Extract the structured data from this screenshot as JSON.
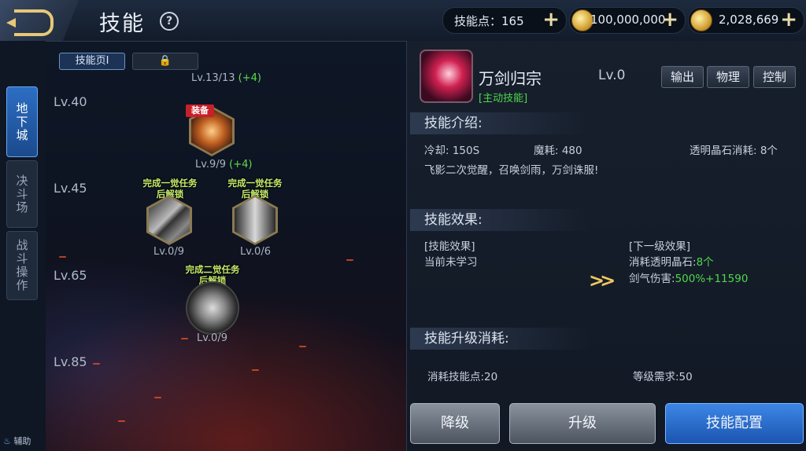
{
  "header": {
    "title": "技能",
    "skill_points_label": "技能点：165",
    "gold": "100,000,000",
    "coupon": "2,028,669"
  },
  "left_tabs": [
    "地下城",
    "决斗场",
    "战斗操作"
  ],
  "assist_label": "辅助",
  "tree": {
    "page_label": "技能页Ⅰ",
    "level_labels": [
      "Lv.40",
      "Lv.45",
      "Lv.65",
      "Lv.85"
    ],
    "top_level": "Lv.13/13",
    "top_bonus": "(+4)",
    "equip_tag": "装备",
    "node1_level": "Lv.9/9",
    "node1_bonus": "(+4)",
    "lock1_text": "完成一觉任务后解锁",
    "node2_level": "Lv.0/9",
    "lock2_text": "完成一觉任务后解锁",
    "node3_level": "Lv.0/6",
    "lock3_text": "完成二觉任务后解锁",
    "node4_level": "Lv.0/9"
  },
  "skill": {
    "name": "万剑归宗",
    "type": "[主动技能]",
    "level": "Lv.0",
    "tags": [
      "输出",
      "物理",
      "控制"
    ]
  },
  "intro": {
    "header": "技能介绍:",
    "cooldown": "冷却: 150S",
    "mp": "魔耗: 480",
    "crystal": "透明晶石消耗: 8个",
    "desc": "飞影二次觉醒，召唤剑雨，万剑诛服!"
  },
  "effect": {
    "header": "技能效果:",
    "current_title": "[技能效果]",
    "current_text": "当前未学习",
    "next_title": "[下一级效果]",
    "next_line1_label": "消耗透明晶石:",
    "next_line1_value": "8个",
    "next_line2_label": "剑气伤害:",
    "next_line2_value": "500%+11590"
  },
  "upgrade": {
    "header": "技能升级消耗:",
    "points_cost": "消耗技能点:20",
    "level_req": "等级需求:50"
  },
  "buttons": {
    "downgrade": "降级",
    "upgrade": "升级",
    "config": "技能配置"
  }
}
